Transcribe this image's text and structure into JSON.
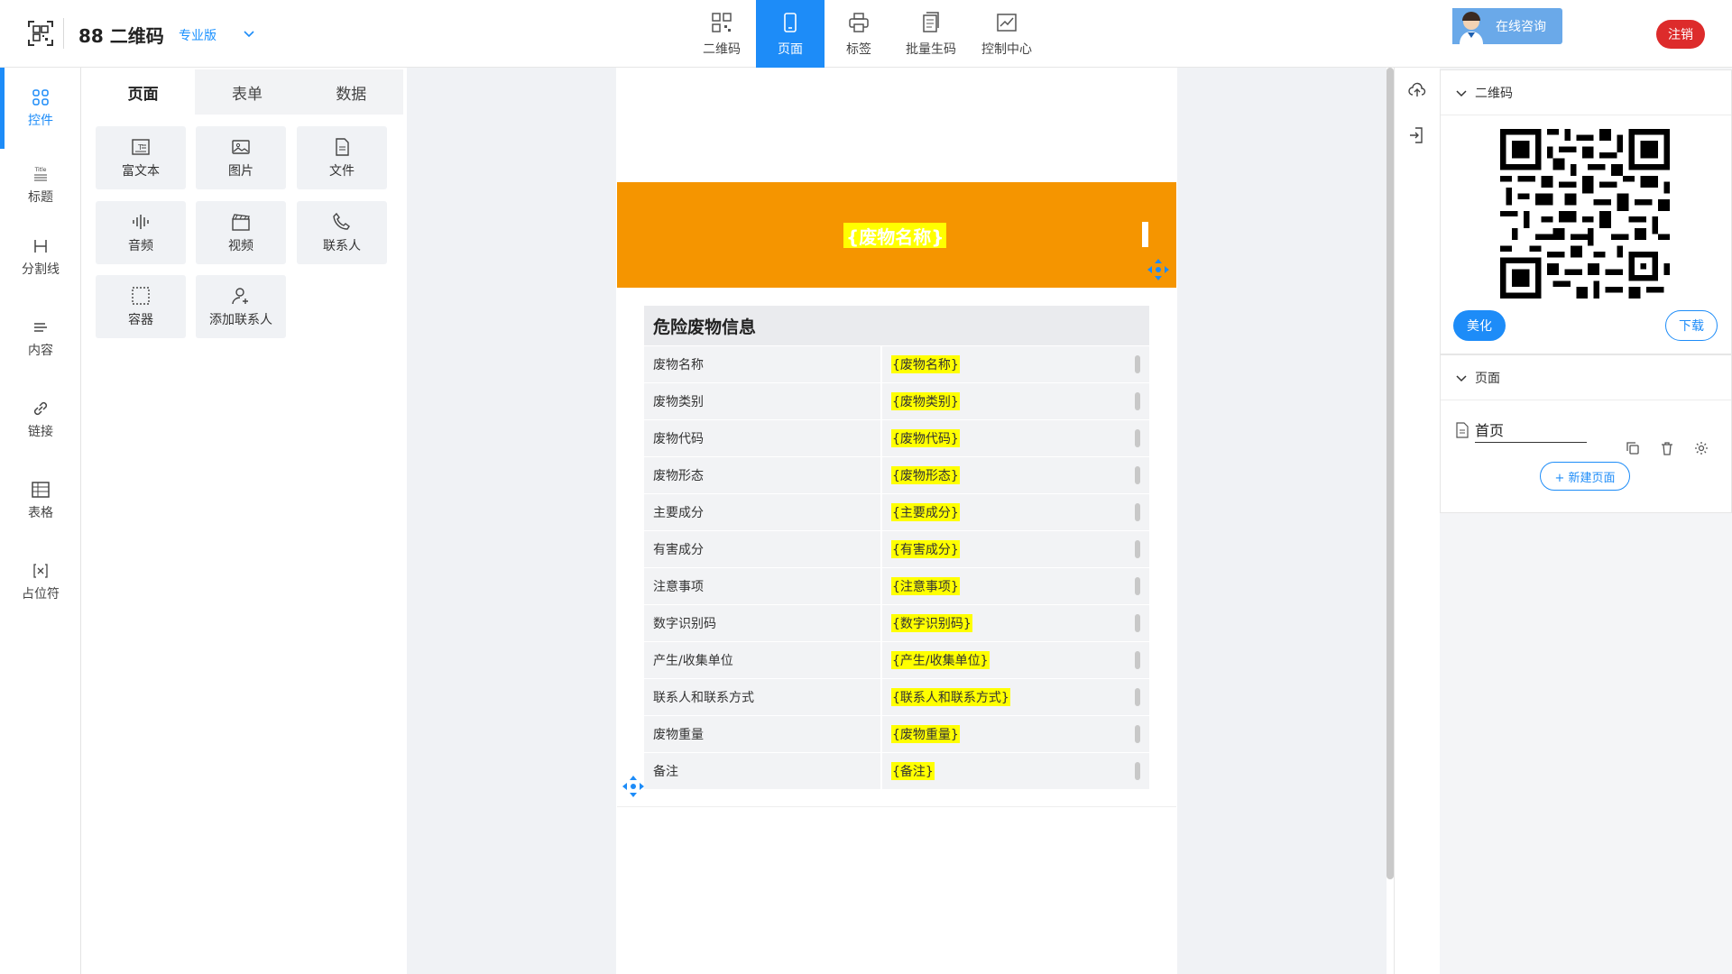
{
  "app": {
    "brand": "88 二维码",
    "edition": "专业版"
  },
  "nav": {
    "items": [
      {
        "label": "二维码",
        "icon": "qrcode-icon"
      },
      {
        "label": "页面",
        "icon": "mobile-page-icon",
        "active": true
      },
      {
        "label": "标签",
        "icon": "printer-icon"
      },
      {
        "label": "批量生码",
        "icon": "batch-icon"
      },
      {
        "label": "控制中心",
        "icon": "control-center-icon"
      }
    ]
  },
  "header_right": {
    "consult_label": "在线咨询",
    "logout_label": "注销"
  },
  "rail": {
    "items": [
      {
        "label": "控件",
        "icon": "grid-icon",
        "active": true
      },
      {
        "label": "标题",
        "icon": "title-icon"
      },
      {
        "label": "分割线",
        "icon": "divider-icon"
      },
      {
        "label": "内容",
        "icon": "content-icon"
      },
      {
        "label": "链接",
        "icon": "link-icon"
      },
      {
        "label": "表格",
        "icon": "table-icon"
      },
      {
        "label": "占位符",
        "icon": "placeholder-icon"
      }
    ]
  },
  "panel": {
    "tabs": [
      {
        "label": "页面",
        "active": true
      },
      {
        "label": "表单"
      },
      {
        "label": "数据"
      }
    ],
    "widgets": [
      {
        "label": "富文本",
        "icon": "rich-text-icon"
      },
      {
        "label": "图片",
        "icon": "image-icon"
      },
      {
        "label": "文件",
        "icon": "file-icon"
      },
      {
        "label": "音频",
        "icon": "audio-icon"
      },
      {
        "label": "视频",
        "icon": "video-icon"
      },
      {
        "label": "联系人",
        "icon": "phone-icon"
      },
      {
        "label": "容器",
        "icon": "container-icon"
      },
      {
        "label": "添加联系人",
        "icon": "add-contact-icon"
      }
    ]
  },
  "canvas": {
    "header_title": "{废物名称}",
    "header_color": "#f59500",
    "highlight_color": "#ffff00",
    "info": {
      "title": "危险废物信息",
      "rows": [
        {
          "label": "废物名称",
          "value": "{废物名称}"
        },
        {
          "label": "废物类别",
          "value": "{废物类别}"
        },
        {
          "label": "废物代码",
          "value": "{废物代码}"
        },
        {
          "label": "废物形态",
          "value": "{废物形态}"
        },
        {
          "label": "主要成分",
          "value": "{主要成分}"
        },
        {
          "label": "有害成分",
          "value": "{有害成分}"
        },
        {
          "label": "注意事项",
          "value": "{注意事项}"
        },
        {
          "label": "数字识别码",
          "value": "{数字识别码}"
        },
        {
          "label": "产生/收集单位",
          "value": "{产生/收集单位}"
        },
        {
          "label": "联系人和联系方式",
          "value": "{联系人和联系方式}"
        },
        {
          "label": "废物重量",
          "value": "{废物重量}"
        },
        {
          "label": "备注",
          "value": "{备注}"
        }
      ]
    }
  },
  "right_panel": {
    "qr_section_title": "二维码",
    "beautify_label": "美化",
    "download_label": "下载",
    "page_section_title": "页面",
    "page_name": "首页",
    "new_page_label": "+ 新建页面"
  },
  "colors": {
    "accent": "#1d8cf8",
    "danger": "#dd2b2b"
  }
}
